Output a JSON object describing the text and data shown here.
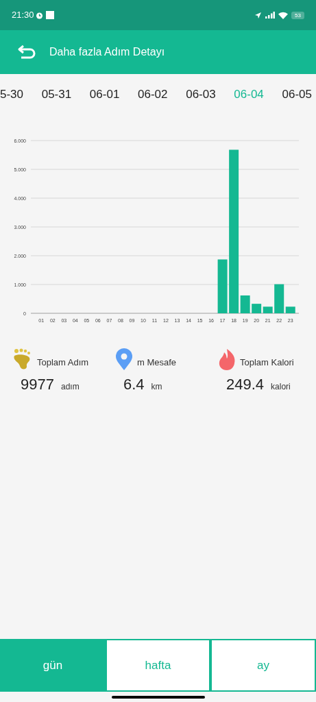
{
  "status_bar": {
    "time": "21:30",
    "battery": "53"
  },
  "header": {
    "title": "Daha fazla Adım Detayı"
  },
  "dates": [
    {
      "label": "5-30",
      "selected": false
    },
    {
      "label": "05-31",
      "selected": false
    },
    {
      "label": "06-01",
      "selected": false
    },
    {
      "label": "06-02",
      "selected": false
    },
    {
      "label": "06-03",
      "selected": false
    },
    {
      "label": "06-04",
      "selected": true
    },
    {
      "label": "06-05",
      "selected": false
    }
  ],
  "chart_data": {
    "type": "bar",
    "categories": [
      "01",
      "02",
      "03",
      "04",
      "05",
      "06",
      "07",
      "08",
      "09",
      "10",
      "11",
      "12",
      "13",
      "14",
      "15",
      "16",
      "17",
      "18",
      "19",
      "20",
      "21",
      "22",
      "23"
    ],
    "values": [
      0,
      0,
      0,
      0,
      0,
      0,
      0,
      0,
      0,
      0,
      0,
      0,
      0,
      0,
      0,
      0,
      1.87,
      5.68,
      0.62,
      0.33,
      0.23,
      1.01,
      0.23
    ],
    "ylim": [
      0,
      6
    ],
    "grid": true,
    "yticks": [
      {
        "value": 0,
        "label": "0"
      },
      {
        "value": 1,
        "label": "1.000"
      },
      {
        "value": 2,
        "label": "2.000"
      },
      {
        "value": 3,
        "label": "3.000"
      },
      {
        "value": 4,
        "label": "4.000"
      },
      {
        "value": 5,
        "label": "5.000"
      },
      {
        "value": 6,
        "label": "6.000"
      }
    ]
  },
  "stats": [
    {
      "kind": "steps",
      "label": "Toplam Adım",
      "value": "9977",
      "unit": "adım"
    },
    {
      "kind": "distance",
      "label": "m Mesafe",
      "value": "6.4",
      "unit": "km"
    },
    {
      "kind": "calories",
      "label": "Toplam Kalori",
      "value": "249.4",
      "unit": "kalori"
    }
  ],
  "bottom_tabs": [
    {
      "label": "gün",
      "selected": true
    },
    {
      "label": "hafta",
      "selected": false
    },
    {
      "label": "ay",
      "selected": false
    }
  ]
}
